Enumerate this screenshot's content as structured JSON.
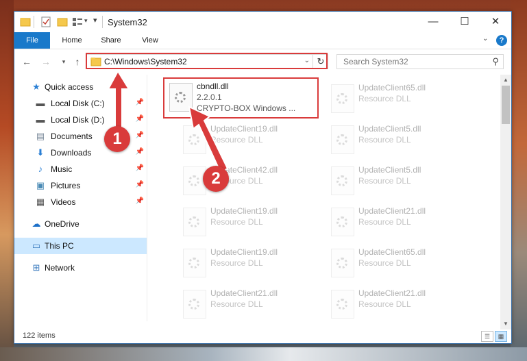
{
  "window": {
    "title": "System32",
    "minimize": "—",
    "maximize": "☐",
    "close": "✕"
  },
  "ribbon": {
    "tabs": [
      "File",
      "Home",
      "Share",
      "View"
    ],
    "help": "?"
  },
  "address": {
    "path": "C:\\Windows\\System32",
    "search_placeholder": "Search System32"
  },
  "sidebar": {
    "items": [
      {
        "label": "Quick access",
        "icon": "star-icon",
        "pinned": false
      },
      {
        "label": "Local Disk (C:)",
        "icon": "drive-icon",
        "pinned": true
      },
      {
        "label": "Local Disk (D:)",
        "icon": "drive-icon",
        "pinned": true
      },
      {
        "label": "Documents",
        "icon": "document-icon",
        "pinned": true
      },
      {
        "label": "Downloads",
        "icon": "download-icon",
        "pinned": true
      },
      {
        "label": "Music",
        "icon": "music-icon",
        "pinned": true
      },
      {
        "label": "Pictures",
        "icon": "picture-icon",
        "pinned": true
      },
      {
        "label": "Videos",
        "icon": "video-icon",
        "pinned": true
      },
      {
        "label": "OneDrive",
        "icon": "cloud-icon",
        "pinned": false
      },
      {
        "label": "This PC",
        "icon": "computer-icon",
        "pinned": false,
        "selected": true
      },
      {
        "label": "Network",
        "icon": "network-icon",
        "pinned": false
      }
    ]
  },
  "files": [
    {
      "name": "cbndll.dll",
      "line2": "2.2.0.1",
      "line3": "CRYPTO-BOX Windows ...",
      "active": true
    },
    {
      "name": "UpdateClient65.dll",
      "line2": "Resource DLL",
      "line3": ""
    },
    {
      "name": "UpdateClient19.dll",
      "line2": "Resource DLL",
      "line3": ""
    },
    {
      "name": "UpdateClient5.dll",
      "line2": "Resource DLL",
      "line3": ""
    },
    {
      "name": "UpdateClient42.dll",
      "line2": "Resource DLL",
      "line3": ""
    },
    {
      "name": "UpdateClient5.dll",
      "line2": "Resource DLL",
      "line3": ""
    },
    {
      "name": "UpdateClient19.dll",
      "line2": "Resource DLL",
      "line3": ""
    },
    {
      "name": "UpdateClient21.dll",
      "line2": "Resource DLL",
      "line3": ""
    },
    {
      "name": "UpdateClient19.dll",
      "line2": "Resource DLL",
      "line3": ""
    },
    {
      "name": "UpdateClient65.dll",
      "line2": "Resource DLL",
      "line3": ""
    },
    {
      "name": "UpdateClient21.dll",
      "line2": "Resource DLL",
      "line3": ""
    },
    {
      "name": "UpdateClient21.dll",
      "line2": "Resource DLL",
      "line3": ""
    }
  ],
  "status": {
    "item_count": "122 items"
  },
  "annotations": {
    "step1": "1",
    "step2": "2",
    "color": "#d93b3b"
  }
}
